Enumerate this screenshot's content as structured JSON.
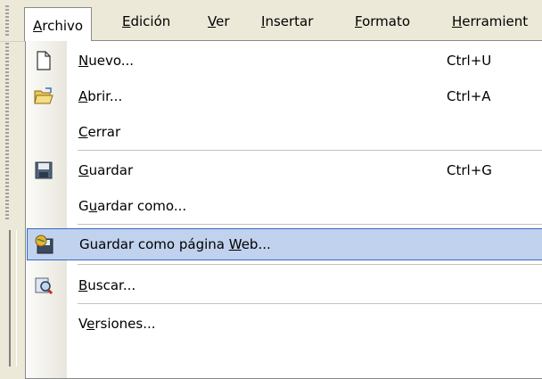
{
  "menubar": {
    "items": [
      {
        "pre": "",
        "u": "A",
        "post": "rchivo"
      },
      {
        "pre": "",
        "u": "E",
        "post": "dición"
      },
      {
        "pre": "",
        "u": "V",
        "post": "er"
      },
      {
        "pre": "",
        "u": "I",
        "post": "nsertar"
      },
      {
        "pre": "",
        "u": "F",
        "post": "ormato"
      },
      {
        "pre": "",
        "u": "H",
        "post": "erramient"
      }
    ]
  },
  "menu": {
    "nuevo": {
      "pre": "",
      "u": "N",
      "post": "uevo...",
      "shortcut": "Ctrl+U",
      "icon": "new-document-icon"
    },
    "abrir": {
      "pre": "",
      "u": "A",
      "post": "brir...",
      "shortcut": "Ctrl+A",
      "icon": "open-folder-icon"
    },
    "cerrar": {
      "pre": "",
      "u": "C",
      "post": "errar"
    },
    "guardar": {
      "pre": "",
      "u": "G",
      "post": "uardar",
      "shortcut": "Ctrl+G",
      "icon": "save-disk-icon"
    },
    "guardar_como": {
      "pre": "G",
      "u": "u",
      "post": "ardar como..."
    },
    "guardar_web": {
      "pre": "Guardar como página ",
      "u": "W",
      "post": "eb...",
      "icon": "save-web-page-icon"
    },
    "buscar": {
      "pre": "",
      "u": "B",
      "post": "uscar...",
      "icon": "search-file-icon"
    },
    "versiones": {
      "pre": "V",
      "u": "e",
      "post": "rsiones..."
    }
  },
  "colors": {
    "highlight_bg": "#c1d2ee",
    "highlight_border": "#316ac5",
    "bar_bg": "#ece9d8"
  }
}
